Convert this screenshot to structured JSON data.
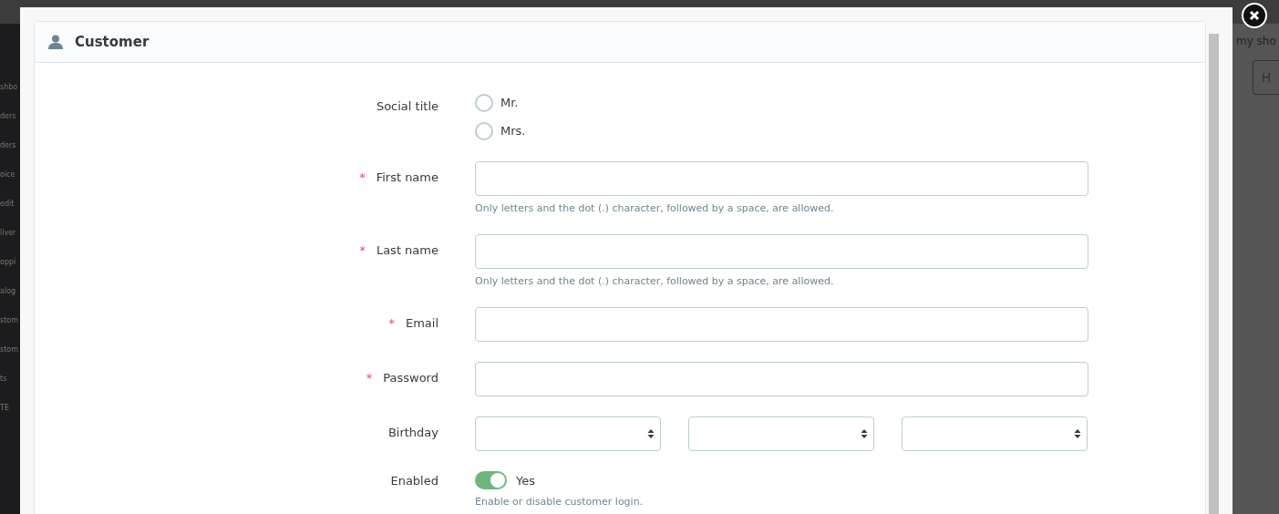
{
  "backdrop": {
    "sidebar_items": [
      "shbo",
      "ders",
      "ders",
      "oice",
      "edit",
      "liver",
      "oppi",
      "alog",
      "stom",
      "stom",
      "ts",
      "TE"
    ],
    "shop_link": "my sho",
    "header_button": "H"
  },
  "modal": {
    "title": "Customer",
    "fields": [
      {
        "kind": "radio",
        "label": "Social title",
        "options": [
          {
            "label": "Mr.",
            "selected": false
          },
          {
            "label": "Mrs.",
            "selected": false
          }
        ]
      },
      {
        "kind": "text",
        "required_mark": "*",
        "label": "First name",
        "help": "Only letters and the dot (.) character, followed by a space, are allowed."
      },
      {
        "kind": "text",
        "required_mark": "*",
        "label": "Last name",
        "help": "Only letters and the dot (.) character, followed by a space, are allowed."
      },
      {
        "kind": "text",
        "required_mark": "*",
        "label": "Email"
      },
      {
        "kind": "password",
        "required_mark": "*",
        "label": "Password"
      },
      {
        "kind": "selects",
        "label": "Birthday",
        "dropdowns": [
          {
            "kind": "select"
          },
          {
            "kind": "select"
          },
          {
            "kind": "select"
          }
        ]
      },
      {
        "kind": "switch",
        "label": "Enabled",
        "on": true,
        "value": "Yes",
        "help": "Enable or disable customer login."
      }
    ]
  }
}
